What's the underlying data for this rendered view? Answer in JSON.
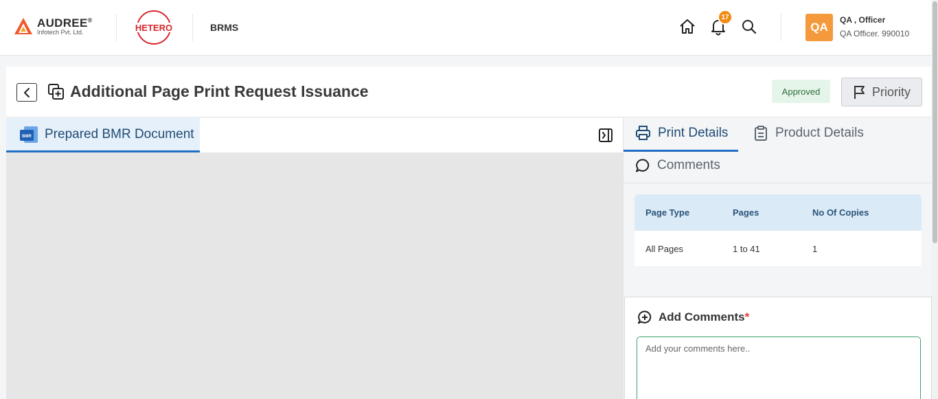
{
  "header": {
    "company_brand": "AUDREE",
    "company_registered": "®",
    "company_sub": "Infotech Pvt. Ltd.",
    "client_logo_text": "HETERO",
    "app_name": "BRMS",
    "notification_count": "17",
    "user": {
      "avatar_initials": "QA",
      "name": "QA , Officer",
      "role": "QA Officer. 990010"
    }
  },
  "page": {
    "title": "Additional Page Print Request Issuance",
    "status": "Approved",
    "priority_label": "Priority"
  },
  "left_panel": {
    "tab_label": "Prepared BMR Document",
    "doc_icon_text": "BMR"
  },
  "right_panel": {
    "tabs": [
      {
        "label": "Print Details",
        "active": true
      },
      {
        "label": "Product Details",
        "active": false
      },
      {
        "label": "Comments",
        "active": false
      }
    ],
    "table": {
      "headers": [
        "Page Type",
        "Pages",
        "No Of Copies"
      ],
      "rows": [
        [
          "All Pages",
          "1 to 41",
          "1"
        ]
      ]
    },
    "add_comments": {
      "title": "Add Comments",
      "required_mark": "*",
      "placeholder": "Add your comments here.."
    }
  },
  "colors": {
    "accent": "#1f6fc4",
    "avatar": "#f59a3c",
    "badge": "#f28b13",
    "status_bg": "#e5f5ea",
    "table_header": "#dbeaf7"
  }
}
